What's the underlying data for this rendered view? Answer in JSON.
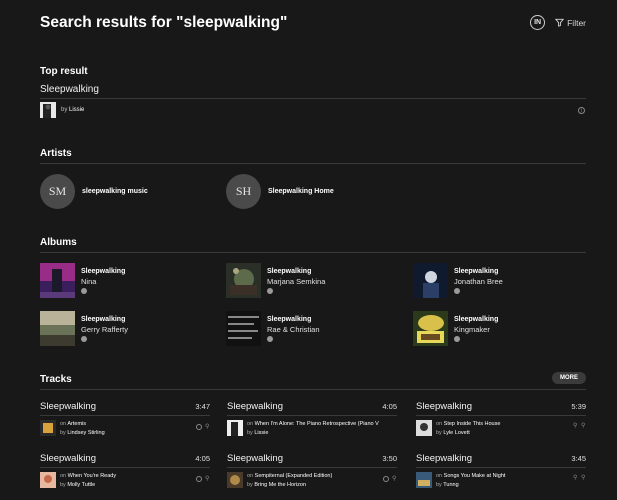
{
  "header": {
    "title": "Search results for \"sleepwalking\"",
    "account_initials": "IN",
    "filter_label": "Filter"
  },
  "top_result": {
    "section_label": "Top result",
    "name": "Sleepwalking",
    "by_prefix": "by",
    "artist": "Lissie",
    "info_glyph": "i"
  },
  "artists": {
    "section_label": "Artists",
    "items": [
      {
        "initials": "SM",
        "name": "sleepwalking music"
      },
      {
        "initials": "SH",
        "name": "Sleepwalking Home"
      }
    ]
  },
  "albums": {
    "section_label": "Albums",
    "items": [
      {
        "title": "Sleepwalking",
        "artist": "Nina"
      },
      {
        "title": "Sleepwalking",
        "artist": "Marjana Semkina"
      },
      {
        "title": "Sleepwalking",
        "artist": "Jonathan Bree"
      },
      {
        "title": "Sleepwalking",
        "artist": "Gerry Rafferty"
      },
      {
        "title": "Sleepwalking",
        "artist": "Rae & Christian"
      },
      {
        "title": "Sleepwalking",
        "artist": "Kingmaker"
      }
    ]
  },
  "tracks": {
    "section_label": "Tracks",
    "more_label": "MORE",
    "on_prefix": "on",
    "by_prefix": "by",
    "items": [
      {
        "title": "Sleepwalking",
        "duration": "3:47",
        "album": "Artemis",
        "artist": "Lindsey Stirling"
      },
      {
        "title": "Sleepwalking",
        "duration": "4:05",
        "album": "When I'm Alone: The Piano Retrospective (Piano V",
        "artist": "Lissie"
      },
      {
        "title": "Sleepwalking",
        "duration": "5:39",
        "album": "Step Inside This House",
        "artist": "Lyle Lovett"
      },
      {
        "title": "Sleepwalking",
        "duration": "4:05",
        "album": "When You're Ready",
        "artist": "Molly Tuttle"
      },
      {
        "title": "Sleepwalking",
        "duration": "3:50",
        "album": "Sempiternal (Expanded Edition)",
        "artist": "Bring Me the Horizon"
      },
      {
        "title": "Sleepwalking",
        "duration": "3:45",
        "album": "Songs You Make at Night",
        "artist": "Tunng"
      }
    ]
  },
  "colors": {
    "background": "#181818",
    "divider": "#3a3a3a",
    "text_primary": "#ffffff",
    "text_secondary": "#aaaaaa",
    "avatar_bg": "#4a4a4a"
  }
}
